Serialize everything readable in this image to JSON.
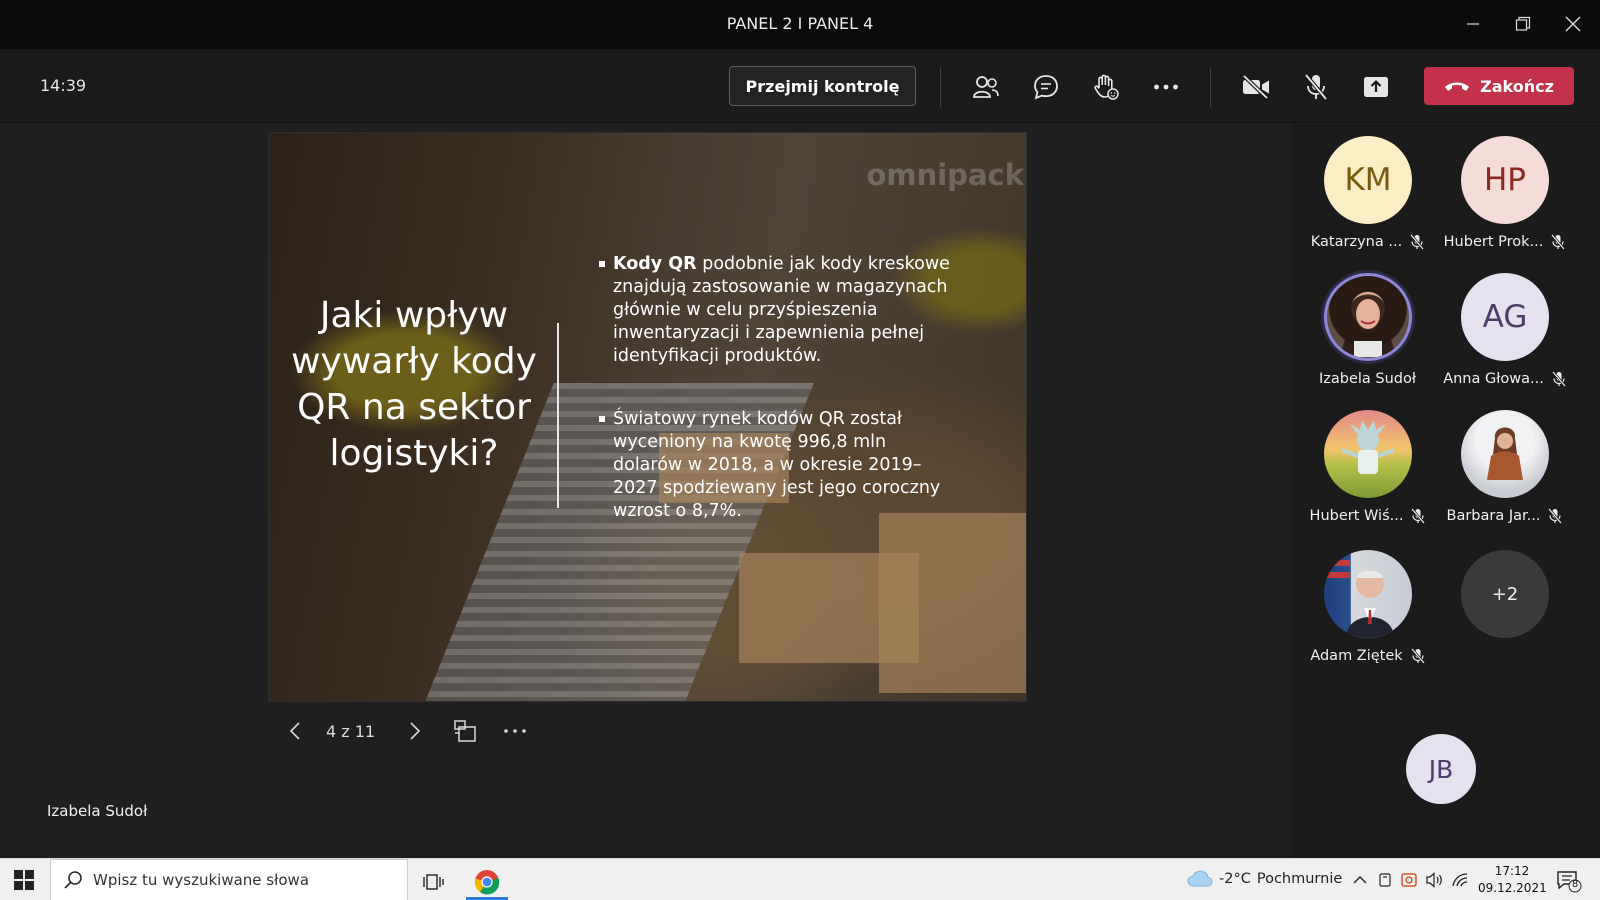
{
  "window": {
    "title": "PANEL 2 I PANEL 4"
  },
  "toolbar": {
    "time": "14:39",
    "take_control_label": "Przejmij kontrolę",
    "end_label": "Zakończ",
    "end_color": "#c4314b"
  },
  "slide": {
    "watermark": "omnipack",
    "question": "Jaki wpływ wywarły kody QR na sektor logistyki?",
    "bullets": [
      {
        "bold": "Kody QR",
        "text": " podobnie jak kody kreskowe znajdują zastosowanie w magazynach  głównie w celu przyśpieszenia inwentaryzacji i zapewnienia pełnej identyfikacji produktów."
      },
      {
        "bold": "",
        "text": "Światowy rynek kodów QR został wyceniony na kwotę 996,8 mln dolarów w 2018, a w okresie 2019–2027 spodziewany jest jego coroczny wzrost o 8,7%."
      }
    ],
    "page_info": "4 z 11",
    "presenter_name": "Izabela Sudoł"
  },
  "participants": [
    {
      "initials": "KM",
      "name": "Katarzyna ...",
      "muted": true,
      "bg": "#fbeec4",
      "fg": "#7a5a12"
    },
    {
      "initials": "HP",
      "name": "Hubert Prok...",
      "muted": true,
      "bg": "#f6dcd8",
      "fg": "#8a2a22"
    },
    {
      "initials": "",
      "name": "Izabela Sudoł",
      "muted": false,
      "speaking": true
    },
    {
      "initials": "AG",
      "name": "Anna Głowa...",
      "muted": true,
      "bg": "#e6e1ee",
      "fg": "#4a3f6a"
    },
    {
      "initials": "",
      "name": "Hubert Wiś...",
      "muted": true
    },
    {
      "initials": "",
      "name": "Barbara Jar...",
      "muted": true
    },
    {
      "initials": "",
      "name": "Adam Ziętek",
      "muted": true
    },
    {
      "initials": "+2",
      "name": "",
      "muted": false
    },
    {
      "initials": "JB",
      "name": "",
      "muted": false,
      "bg": "#e6e1ee",
      "fg": "#4a3f6a"
    }
  ],
  "taskbar": {
    "search_placeholder": "Wpisz tu wyszukiwane słowa",
    "weather_temp": "-2°C",
    "weather_desc": "Pochmurnie",
    "time": "17:12",
    "date": "09.12.2021",
    "notification_count": "8"
  }
}
